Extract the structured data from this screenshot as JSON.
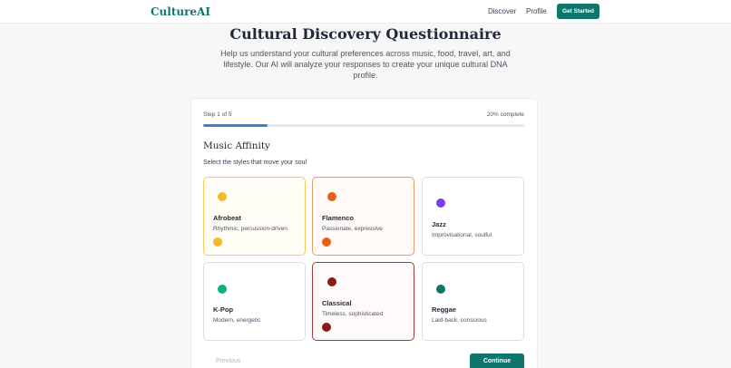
{
  "nav": {
    "brand": "CultureAI",
    "links": [
      "Discover",
      "Profile"
    ],
    "cta": "Get Started"
  },
  "hero": {
    "title": "Cultural Discovery Questionnaire",
    "subtitle": "Help us understand your cultural preferences across music, food, travel, art, and lifestyle. Our AI will analyze your responses to create your unique cultural DNA profile."
  },
  "questionnaire": {
    "step_label": "Step 1 of 5",
    "progress_label": "20% complete",
    "progress_fraction": 0.2,
    "section_title": "Music Affinity",
    "section_subtitle": "Select the styles that move your soul",
    "options": [
      {
        "name": "Afrobeat",
        "desc": "Rhythmic, percussion-driven",
        "color": "#f5b92e",
        "state": "selected-yellow"
      },
      {
        "name": "Flamenco",
        "desc": "Passionate, expressive",
        "color": "#e8611a",
        "state": "selected-orange"
      },
      {
        "name": "Jazz",
        "desc": "Improvisational, soulful",
        "color": "#7c3aed",
        "state": "default"
      },
      {
        "name": "K-Pop",
        "desc": "Modern, energetic",
        "color": "#10b07c",
        "state": "default"
      },
      {
        "name": "Classical",
        "desc": "Timeless, sophisticated",
        "color": "#8b1a1a",
        "state": "selected-red"
      },
      {
        "name": "Reggae",
        "desc": "Laid-back, conscious",
        "color": "#0f766e",
        "state": "default"
      }
    ],
    "previous_label": "Previous",
    "continue_label": "Continue"
  }
}
